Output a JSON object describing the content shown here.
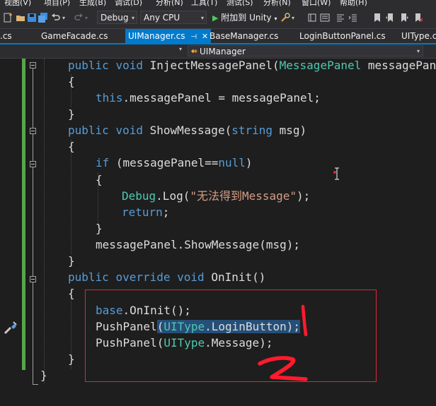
{
  "menu": [
    "视图(V)",
    "项目(P)",
    "生成(B)",
    "调试(D)",
    "分析(N)",
    "工具(T)",
    "测试(S)",
    "分析(N)",
    "窗口(W)",
    "帮助(H)"
  ],
  "toolbar": {
    "configuration": "Debug",
    "platform": "Any CPU",
    "attach_label": "附加到 Unity"
  },
  "tabs": [
    {
      "label": ".cs"
    },
    {
      "label": "GameFacade.cs"
    },
    {
      "label": "UIManager.cs",
      "active": true
    },
    {
      "label": "BaseManager.cs"
    },
    {
      "label": "LoginButtonPanel.cs"
    },
    {
      "label": "UIType.cs"
    }
  ],
  "nav": {
    "class_name": "UIManager"
  },
  "code": [
    [
      [
        "kw",
        "public "
      ],
      [
        "kw",
        "void "
      ],
      [
        "tx",
        "InjectMessagePanel("
      ],
      [
        "ty",
        "MessagePanel"
      ],
      [
        "tx",
        " messagePanel)"
      ]
    ],
    [
      [
        "tx",
        "{"
      ]
    ],
    [
      [
        "kw",
        "this"
      ],
      [
        "tx",
        ".messagePanel = messagePanel;"
      ]
    ],
    [
      [
        "tx",
        "}"
      ]
    ],
    [
      [
        "kw",
        "public "
      ],
      [
        "kw",
        "void "
      ],
      [
        "tx",
        "ShowMessage("
      ],
      [
        "kw",
        "string"
      ],
      [
        "tx",
        " msg)"
      ]
    ],
    [
      [
        "tx",
        "{"
      ]
    ],
    [
      [
        "kw",
        "if"
      ],
      [
        "tx",
        " (messagePanel=="
      ],
      [
        "kw",
        "null"
      ],
      [
        "tx",
        ")"
      ]
    ],
    [
      [
        "tx",
        "{"
      ]
    ],
    [
      [
        "ty",
        "Debug"
      ],
      [
        "tx",
        ".Log("
      ],
      [
        "st",
        "\"无法得到Message\""
      ],
      [
        "tx",
        ");"
      ]
    ],
    [
      [
        "kw",
        "return"
      ],
      [
        "tx",
        ";"
      ]
    ],
    [
      [
        "tx",
        "}"
      ]
    ],
    [
      [
        "tx",
        "messagePanel.ShowMessage(msg);"
      ]
    ],
    [
      [
        "tx",
        "}"
      ]
    ],
    [
      [
        "kw",
        "public "
      ],
      [
        "kw",
        "override "
      ],
      [
        "kw",
        "void "
      ],
      [
        "tx",
        "OnInit()"
      ]
    ],
    [
      [
        "tx",
        "{"
      ]
    ],
    [
      [
        "kw",
        "base"
      ],
      [
        "tx",
        ".OnInit();"
      ]
    ],
    [
      [
        "tx",
        "PushPanel"
      ],
      [
        "tx",
        "(",
        true
      ],
      [
        "ty",
        "UIType",
        true
      ],
      [
        "tx",
        ".LoginButton);",
        true
      ]
    ],
    [
      [
        "tx",
        "PushPanel("
      ],
      [
        "ty",
        "UIType"
      ],
      [
        "tx",
        ".Message);"
      ]
    ],
    [
      [
        "tx",
        "}"
      ]
    ],
    [
      [
        "tx",
        "}"
      ]
    ]
  ]
}
